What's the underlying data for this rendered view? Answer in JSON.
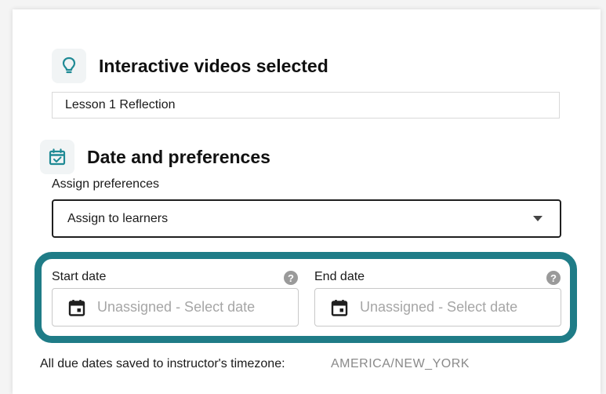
{
  "videos_section": {
    "title": "Interactive videos selected",
    "icon": "lightbulb-icon",
    "selected_video": "Lesson 1 Reflection"
  },
  "dates_section": {
    "title": "Date and preferences",
    "icon": "calendar-check-icon",
    "assign_label": "Assign preferences",
    "assign_value": "Assign to learners",
    "start_label": "Start date",
    "start_placeholder": "Unassigned - Select date",
    "end_label": "End date",
    "end_placeholder": "Unassigned - Select date",
    "help_glyph": "?"
  },
  "timezone": {
    "note": "All due dates saved to instructor's timezone:",
    "value": "AMERICA/NEW_YORK"
  },
  "colors": {
    "accent": "#1f7c87",
    "icon_bg": "#f1f4f5",
    "help_icon": "#9a9a9a",
    "placeholder": "#a6a6a6"
  }
}
